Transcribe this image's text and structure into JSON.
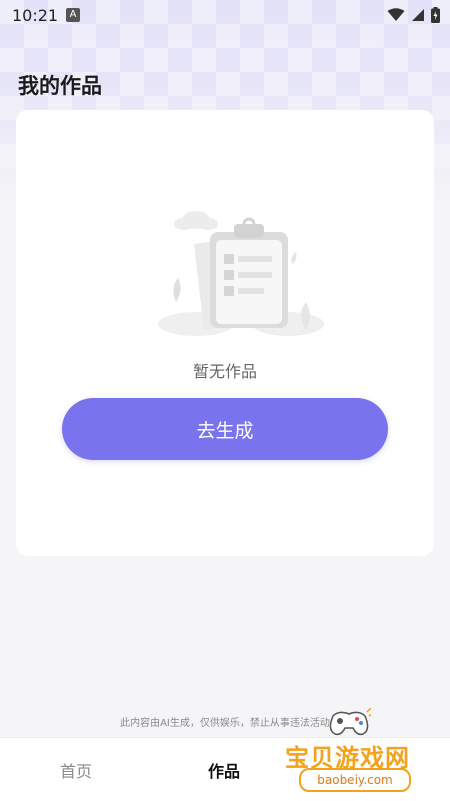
{
  "status_bar": {
    "time": "10:21",
    "app_badge": "A"
  },
  "page": {
    "title": "我的作品"
  },
  "empty_state": {
    "message": "暂无作品",
    "icon": "empty-clipboard-icon"
  },
  "actions": {
    "generate_label": "去生成"
  },
  "footer": {
    "disclaimer": "此内容由AI生成，仅供娱乐，禁止从事违法活动"
  },
  "tabs": [
    {
      "label": "首页"
    },
    {
      "label": "作品"
    }
  ],
  "watermark": {
    "text": "宝贝游戏网",
    "url": "baobeiy.com"
  },
  "colors": {
    "accent": "#7a73ee",
    "background": "#f5f5f7",
    "card": "#ffffff",
    "watermark": "#f4a21b"
  }
}
